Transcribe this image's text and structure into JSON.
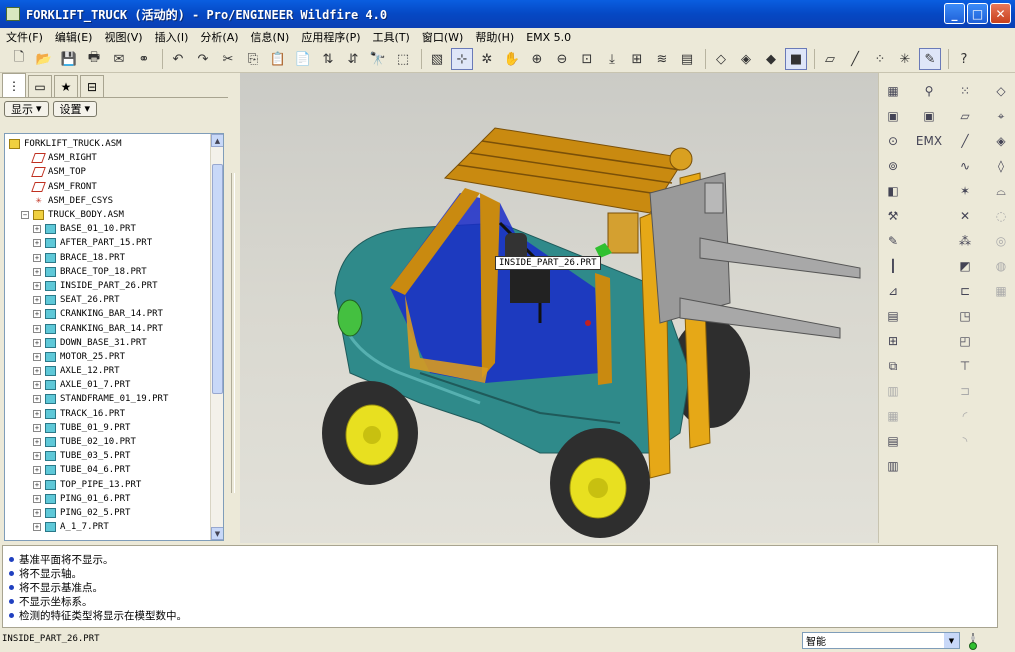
{
  "window": {
    "title": "FORKLIFT_TRUCK (活动的) - Pro/ENGINEER Wildfire 4.0",
    "minimize": "_",
    "maximize": "□",
    "close": "✕"
  },
  "menu": [
    "文件(F)",
    "编辑(E)",
    "视图(V)",
    "插入(I)",
    "分析(A)",
    "信息(N)",
    "应用程序(P)",
    "工具(T)",
    "窗口(W)",
    "帮助(H)",
    "EMX 5.0"
  ],
  "panel": {
    "show_label": "显示",
    "settings_label": "设置",
    "tree": [
      {
        "label": "FORKLIFT_TRUCK.ASM",
        "type": "asm",
        "level": 0,
        "expander": ""
      },
      {
        "label": "ASM_RIGHT",
        "type": "plane",
        "level": 1,
        "expander": ""
      },
      {
        "label": "ASM_TOP",
        "type": "plane",
        "level": 1,
        "expander": ""
      },
      {
        "label": "ASM_FRONT",
        "type": "plane",
        "level": 1,
        "expander": ""
      },
      {
        "label": "ASM_DEF_CSYS",
        "type": "csys",
        "level": 1,
        "expander": ""
      },
      {
        "label": "TRUCK_BODY.ASM",
        "type": "asm",
        "level": 1,
        "expander": "−"
      },
      {
        "label": "BASE_01_10.PRT",
        "type": "part",
        "level": 2,
        "expander": "+"
      },
      {
        "label": "AFTER_PART_15.PRT",
        "type": "part",
        "level": 2,
        "expander": "+"
      },
      {
        "label": "BRACE_18.PRT",
        "type": "part",
        "level": 2,
        "expander": "+"
      },
      {
        "label": "BRACE_TOP_18.PRT",
        "type": "part",
        "level": 2,
        "expander": "+"
      },
      {
        "label": "INSIDE_PART_26.PRT",
        "type": "part",
        "level": 2,
        "expander": "+"
      },
      {
        "label": "SEAT_26.PRT",
        "type": "part",
        "level": 2,
        "expander": "+"
      },
      {
        "label": "CRANKING_BAR_14.PRT",
        "type": "part",
        "level": 2,
        "expander": "+"
      },
      {
        "label": "CRANKING_BAR_14.PRT",
        "type": "part",
        "level": 2,
        "expander": "+"
      },
      {
        "label": "DOWN_BASE_31.PRT",
        "type": "part",
        "level": 2,
        "expander": "+"
      },
      {
        "label": "MOTOR_25.PRT",
        "type": "part",
        "level": 2,
        "expander": "+"
      },
      {
        "label": "AXLE_12.PRT",
        "type": "part",
        "level": 2,
        "expander": "+"
      },
      {
        "label": "AXLE_01_7.PRT",
        "type": "part",
        "level": 2,
        "expander": "+"
      },
      {
        "label": "STANDFRAME_01_19.PRT",
        "type": "part",
        "level": 2,
        "expander": "+"
      },
      {
        "label": "TRACK_16.PRT",
        "type": "part",
        "level": 2,
        "expander": "+"
      },
      {
        "label": "TUBE_01_9.PRT",
        "type": "part",
        "level": 2,
        "expander": "+"
      },
      {
        "label": "TUBE_02_10.PRT",
        "type": "part",
        "level": 2,
        "expander": "+"
      },
      {
        "label": "TUBE_03_5.PRT",
        "type": "part",
        "level": 2,
        "expander": "+"
      },
      {
        "label": "TUBE_04_6.PRT",
        "type": "part",
        "level": 2,
        "expander": "+"
      },
      {
        "label": "TOP_PIPE_13.PRT",
        "type": "part",
        "level": 2,
        "expander": "+"
      },
      {
        "label": "PING_01_6.PRT",
        "type": "part",
        "level": 2,
        "expander": "+"
      },
      {
        "label": "PING_02_5.PRT",
        "type": "part",
        "level": 2,
        "expander": "+"
      },
      {
        "label": "A_1_7.PRT",
        "type": "part",
        "level": 2,
        "expander": "+"
      }
    ]
  },
  "graphics": {
    "tooltip": "INSIDE_PART_26.PRT",
    "emx_label": "EMX"
  },
  "messages": [
    "基准平面将不显示。",
    "将不显示轴。",
    "将不显示基准点。",
    "不显示坐标系。",
    "检测的特征类型将显示在模型数中。"
  ],
  "status": {
    "selection": "INSIDE_PART_26.PRT",
    "filter_value": "智能"
  },
  "colors": {
    "body": "#2f8a8a",
    "frame": "#c98a10",
    "mast": "#e6a817",
    "fork": "#9a9a9a",
    "tire": "#333333",
    "rim": "#e8e020",
    "glass": "#1a2cc8"
  }
}
